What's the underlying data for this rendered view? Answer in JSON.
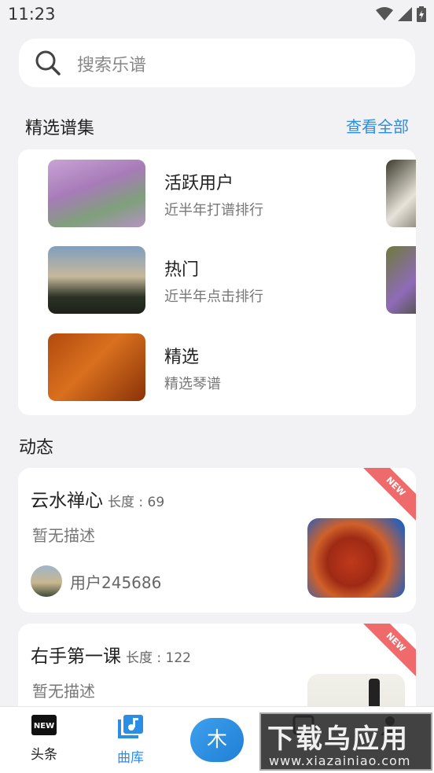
{
  "status": {
    "time": "11:23"
  },
  "search": {
    "placeholder": "搜索乐谱"
  },
  "featured": {
    "title": "精选谱集",
    "see_all": "查看全部",
    "items": [
      {
        "title": "活跃用户",
        "subtitle": "近半年打谱排行"
      },
      {
        "title": "热门",
        "subtitle": "近半年点击排行"
      },
      {
        "title": "精选",
        "subtitle": "精选琴谱"
      }
    ]
  },
  "feed": {
    "title": "动态",
    "items": [
      {
        "title": "云水禅心",
        "length_label": "长度 : 69",
        "description": "暂无描述",
        "user": "用户245686",
        "badge": "NEW"
      },
      {
        "title": "右手第一课",
        "length_label": "长度 : 122",
        "description": "暂无描述",
        "user": "",
        "badge": "NEW"
      }
    ]
  },
  "nav": {
    "items": [
      {
        "label": "头条",
        "icon": "new-icon"
      },
      {
        "label": "曲库",
        "icon": "music-library-icon"
      },
      {
        "label": "木",
        "icon": "center-logo"
      },
      {
        "label": "",
        "icon": "content-icon"
      },
      {
        "label": "",
        "icon": "profile-icon"
      }
    ],
    "active_color": "#2c8de6"
  },
  "watermark": {
    "text": "下载乌应用",
    "url": "www.xiazainiao.com"
  }
}
